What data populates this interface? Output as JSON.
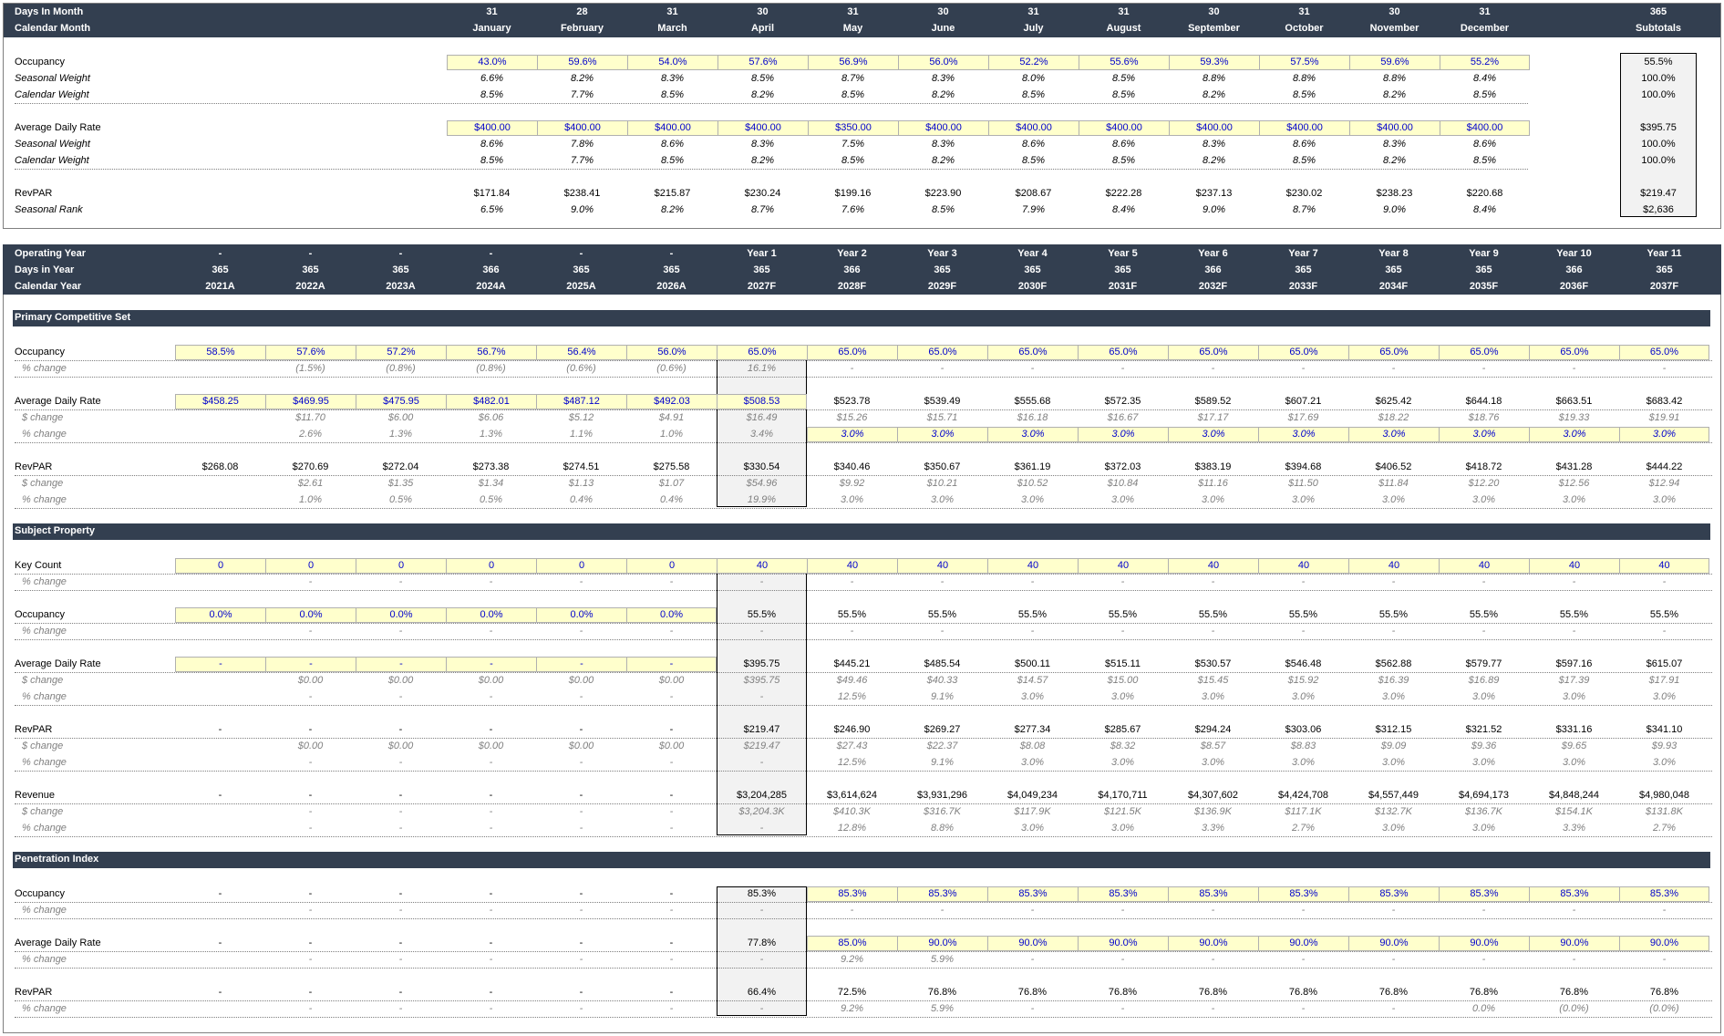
{
  "monthly": {
    "header_rows": [
      {
        "label": "Days In Month",
        "values": [
          "31",
          "28",
          "31",
          "30",
          "31",
          "30",
          "31",
          "31",
          "30",
          "31",
          "30",
          "31"
        ],
        "total": "365"
      },
      {
        "label": "Calendar Month",
        "values": [
          "January",
          "February",
          "March",
          "April",
          "May",
          "June",
          "July",
          "August",
          "September",
          "October",
          "November",
          "December"
        ],
        "total": "Subtotals"
      }
    ],
    "rows": [
      {
        "label": "Occupancy",
        "style": "input",
        "values": [
          "43.0%",
          "59.6%",
          "54.0%",
          "57.6%",
          "56.9%",
          "56.0%",
          "52.2%",
          "55.6%",
          "59.3%",
          "57.5%",
          "59.6%",
          "55.2%"
        ],
        "total": "55.5%"
      },
      {
        "label": "Seasonal Weight",
        "style": "italic",
        "values": [
          "6.6%",
          "8.2%",
          "8.3%",
          "8.5%",
          "8.7%",
          "8.3%",
          "8.0%",
          "8.5%",
          "8.8%",
          "8.8%",
          "8.8%",
          "8.4%"
        ],
        "total": "100.0%"
      },
      {
        "label": "Calendar Weight",
        "style": "italic-dotted",
        "values": [
          "8.5%",
          "7.7%",
          "8.5%",
          "8.2%",
          "8.5%",
          "8.2%",
          "8.5%",
          "8.5%",
          "8.2%",
          "8.5%",
          "8.2%",
          "8.5%"
        ],
        "total": "100.0%"
      },
      {
        "label": "Average Daily Rate",
        "style": "input",
        "values": [
          "$400.00",
          "$400.00",
          "$400.00",
          "$400.00",
          "$350.00",
          "$400.00",
          "$400.00",
          "$400.00",
          "$400.00",
          "$400.00",
          "$400.00",
          "$400.00"
        ],
        "total": "$395.75"
      },
      {
        "label": "Seasonal Weight",
        "style": "italic",
        "values": [
          "8.6%",
          "7.8%",
          "8.6%",
          "8.3%",
          "7.5%",
          "8.3%",
          "8.6%",
          "8.6%",
          "8.3%",
          "8.6%",
          "8.3%",
          "8.6%"
        ],
        "total": "100.0%"
      },
      {
        "label": "Calendar Weight",
        "style": "italic-dotted",
        "values": [
          "8.5%",
          "7.7%",
          "8.5%",
          "8.2%",
          "8.5%",
          "8.2%",
          "8.5%",
          "8.5%",
          "8.2%",
          "8.5%",
          "8.2%",
          "8.5%"
        ],
        "total": "100.0%"
      },
      {
        "label": "RevPAR",
        "style": "normal",
        "values": [
          "$171.84",
          "$238.41",
          "$215.87",
          "$230.24",
          "$199.16",
          "$223.90",
          "$208.67",
          "$222.28",
          "$237.13",
          "$230.02",
          "$238.23",
          "$220.68"
        ],
        "total": "$219.47"
      },
      {
        "label": "Seasonal Rank",
        "style": "italic",
        "values": [
          "6.5%",
          "9.0%",
          "8.2%",
          "8.7%",
          "7.6%",
          "8.5%",
          "7.9%",
          "8.4%",
          "9.0%",
          "8.7%",
          "9.0%",
          "8.4%"
        ],
        "total": "$2,636"
      }
    ]
  },
  "annual": {
    "header_rows": [
      {
        "label": "Operating Year",
        "values": [
          "-",
          "-",
          "-",
          "-",
          "-",
          "-",
          "Year 1",
          "Year 2",
          "Year 3",
          "Year 4",
          "Year 5",
          "Year 6",
          "Year 7",
          "Year 8",
          "Year 9",
          "Year 10",
          "Year 11"
        ]
      },
      {
        "label": "Days in Year",
        "values": [
          "365",
          "365",
          "365",
          "366",
          "365",
          "365",
          "365",
          "366",
          "365",
          "365",
          "365",
          "366",
          "365",
          "365",
          "365",
          "366",
          "365"
        ]
      },
      {
        "label": "Calendar Year",
        "values": [
          "2021A",
          "2022A",
          "2023A",
          "2024A",
          "2025A",
          "2026A",
          "2027F",
          "2028F",
          "2029F",
          "2030F",
          "2031F",
          "2032F",
          "2033F",
          "2034F",
          "2035F",
          "2036F",
          "2037F"
        ]
      }
    ],
    "sections": [
      {
        "title": "Primary Competitive Set",
        "rows": [
          {
            "label": "Occupancy",
            "style": "normal",
            "values": [
              "58.5%",
              "57.6%",
              "57.2%",
              "56.7%",
              "56.4%",
              "56.0%",
              "65.0%",
              "65.0%",
              "65.0%",
              "65.0%",
              "65.0%",
              "65.0%",
              "65.0%",
              "65.0%",
              "65.0%",
              "65.0%",
              "65.0%"
            ]
          },
          {
            "label": "% change",
            "style": "sub",
            "values": [
              "",
              "(1.5%)",
              "(0.8%)",
              "(0.8%)",
              "(0.6%)",
              "(0.6%)",
              "16.1%",
              "-",
              "-",
              "-",
              "-",
              "-",
              "-",
              "-",
              "-",
              "-",
              "-"
            ]
          },
          {
            "label": "Average Daily Rate",
            "style": "normal",
            "values": [
              "$458.25",
              "$469.95",
              "$475.95",
              "$482.01",
              "$487.12",
              "$492.03",
              "$508.53",
              "$523.78",
              "$539.49",
              "$555.68",
              "$572.35",
              "$589.52",
              "$607.21",
              "$625.42",
              "$644.18",
              "$663.51",
              "$683.42"
            ]
          },
          {
            "label": "$ change",
            "style": "sub",
            "values": [
              "",
              "$11.70",
              "$6.00",
              "$6.06",
              "$5.12",
              "$4.91",
              "$16.49",
              "$15.26",
              "$15.71",
              "$16.18",
              "$16.67",
              "$17.17",
              "$17.69",
              "$18.22",
              "$18.76",
              "$19.33",
              "$19.91"
            ]
          },
          {
            "label": "% change",
            "style": "sub",
            "values": [
              "",
              "2.6%",
              "1.3%",
              "1.3%",
              "1.1%",
              "1.0%",
              "3.4%",
              "3.0%",
              "3.0%",
              "3.0%",
              "3.0%",
              "3.0%",
              "3.0%",
              "3.0%",
              "3.0%",
              "3.0%",
              "3.0%"
            ]
          },
          {
            "label": "RevPAR",
            "style": "normal",
            "values": [
              "$268.08",
              "$270.69",
              "$272.04",
              "$273.38",
              "$274.51",
              "$275.58",
              "$330.54",
              "$340.46",
              "$350.67",
              "$361.19",
              "$372.03",
              "$383.19",
              "$394.68",
              "$406.52",
              "$418.72",
              "$431.28",
              "$444.22"
            ]
          },
          {
            "label": "$ change",
            "style": "sub",
            "values": [
              "",
              "$2.61",
              "$1.35",
              "$1.34",
              "$1.13",
              "$1.07",
              "$54.96",
              "$9.92",
              "$10.21",
              "$10.52",
              "$10.84",
              "$11.16",
              "$11.50",
              "$11.84",
              "$12.20",
              "$12.56",
              "$12.94"
            ]
          },
          {
            "label": "% change",
            "style": "sub",
            "values": [
              "",
              "1.0%",
              "0.5%",
              "0.5%",
              "0.4%",
              "0.4%",
              "19.9%",
              "3.0%",
              "3.0%",
              "3.0%",
              "3.0%",
              "3.0%",
              "3.0%",
              "3.0%",
              "3.0%",
              "3.0%",
              "3.0%"
            ]
          }
        ]
      },
      {
        "title": "Subject Property",
        "rows": [
          {
            "label": "Key Count",
            "style": "normal",
            "values": [
              "0",
              "0",
              "0",
              "0",
              "0",
              "0",
              "40",
              "40",
              "40",
              "40",
              "40",
              "40",
              "40",
              "40",
              "40",
              "40",
              "40"
            ]
          },
          {
            "label": "% change",
            "style": "sub",
            "values": [
              "",
              "-",
              "-",
              "-",
              "-",
              "-",
              "-",
              "-",
              "-",
              "-",
              "-",
              "-",
              "-",
              "-",
              "-",
              "-",
              "-"
            ]
          },
          {
            "label": "Occupancy",
            "style": "normal",
            "values": [
              "0.0%",
              "0.0%",
              "0.0%",
              "0.0%",
              "0.0%",
              "0.0%",
              "55.5%",
              "55.5%",
              "55.5%",
              "55.5%",
              "55.5%",
              "55.5%",
              "55.5%",
              "55.5%",
              "55.5%",
              "55.5%",
              "55.5%"
            ]
          },
          {
            "label": "% change",
            "style": "sub",
            "values": [
              "",
              "-",
              "-",
              "-",
              "-",
              "-",
              "-",
              "-",
              "-",
              "-",
              "-",
              "-",
              "-",
              "-",
              "-",
              "-",
              "-"
            ]
          },
          {
            "label": "Average Daily Rate",
            "style": "normal",
            "values": [
              "-",
              "-",
              "-",
              "-",
              "-",
              "-",
              "$395.75",
              "$445.21",
              "$485.54",
              "$500.11",
              "$515.11",
              "$530.57",
              "$546.48",
              "$562.88",
              "$579.77",
              "$597.16",
              "$615.07"
            ]
          },
          {
            "label": "$ change",
            "style": "sub",
            "values": [
              "",
              "$0.00",
              "$0.00",
              "$0.00",
              "$0.00",
              "$0.00",
              "$395.75",
              "$49.46",
              "$40.33",
              "$14.57",
              "$15.00",
              "$15.45",
              "$15.92",
              "$16.39",
              "$16.89",
              "$17.39",
              "$17.91"
            ]
          },
          {
            "label": "% change",
            "style": "sub",
            "values": [
              "",
              "-",
              "-",
              "-",
              "-",
              "-",
              "-",
              "12.5%",
              "9.1%",
              "3.0%",
              "3.0%",
              "3.0%",
              "3.0%",
              "3.0%",
              "3.0%",
              "3.0%",
              "3.0%"
            ]
          },
          {
            "label": "RevPAR",
            "style": "normal",
            "values": [
              "-",
              "-",
              "-",
              "-",
              "-",
              "-",
              "$219.47",
              "$246.90",
              "$269.27",
              "$277.34",
              "$285.67",
              "$294.24",
              "$303.06",
              "$312.15",
              "$321.52",
              "$331.16",
              "$341.10"
            ]
          },
          {
            "label": "$ change",
            "style": "sub",
            "values": [
              "",
              "$0.00",
              "$0.00",
              "$0.00",
              "$0.00",
              "$0.00",
              "$219.47",
              "$27.43",
              "$22.37",
              "$8.08",
              "$8.32",
              "$8.57",
              "$8.83",
              "$9.09",
              "$9.36",
              "$9.65",
              "$9.93"
            ]
          },
          {
            "label": "% change",
            "style": "sub",
            "values": [
              "",
              "-",
              "-",
              "-",
              "-",
              "-",
              "-",
              "12.5%",
              "9.1%",
              "3.0%",
              "3.0%",
              "3.0%",
              "3.0%",
              "3.0%",
              "3.0%",
              "3.0%",
              "3.0%"
            ]
          },
          {
            "label": "Revenue",
            "style": "normal",
            "values": [
              "-",
              "-",
              "-",
              "-",
              "-",
              "-",
              "$3,204,285",
              "$3,614,624",
              "$3,931,296",
              "$4,049,234",
              "$4,170,711",
              "$4,307,602",
              "$4,424,708",
              "$4,557,449",
              "$4,694,173",
              "$4,848,244",
              "$4,980,048"
            ]
          },
          {
            "label": "$ change",
            "style": "sub",
            "values": [
              "",
              "-",
              "-",
              "-",
              "-",
              "-",
              "$3,204.3K",
              "$410.3K",
              "$316.7K",
              "$117.9K",
              "$121.5K",
              "$136.9K",
              "$117.1K",
              "$132.7K",
              "$136.7K",
              "$154.1K",
              "$131.8K"
            ]
          },
          {
            "label": "% change",
            "style": "sub",
            "values": [
              "",
              "-",
              "-",
              "-",
              "-",
              "-",
              "-",
              "12.8%",
              "8.8%",
              "3.0%",
              "3.0%",
              "3.3%",
              "2.7%",
              "3.0%",
              "3.0%",
              "3.3%",
              "2.7%"
            ]
          }
        ]
      },
      {
        "title": "Penetration Index",
        "rows": [
          {
            "label": "Occupancy",
            "style": "normal",
            "values": [
              "-",
              "-",
              "-",
              "-",
              "-",
              "-",
              "85.3%",
              "85.3%",
              "85.3%",
              "85.3%",
              "85.3%",
              "85.3%",
              "85.3%",
              "85.3%",
              "85.3%",
              "85.3%",
              "85.3%"
            ]
          },
          {
            "label": "% change",
            "style": "sub",
            "values": [
              "",
              "-",
              "-",
              "-",
              "-",
              "-",
              "-",
              "-",
              "-",
              "-",
              "-",
              "-",
              "-",
              "-",
              "-",
              "-",
              "-"
            ]
          },
          {
            "label": "Average Daily Rate",
            "style": "normal",
            "values": [
              "-",
              "-",
              "-",
              "-",
              "-",
              "-",
              "77.8%",
              "85.0%",
              "90.0%",
              "90.0%",
              "90.0%",
              "90.0%",
              "90.0%",
              "90.0%",
              "90.0%",
              "90.0%",
              "90.0%"
            ]
          },
          {
            "label": "% change",
            "style": "sub",
            "values": [
              "",
              "-",
              "-",
              "-",
              "-",
              "-",
              "-",
              "9.2%",
              "5.9%",
              "-",
              "-",
              "-",
              "-",
              "-",
              "-",
              "-",
              "-"
            ]
          },
          {
            "label": "RevPAR",
            "style": "normal",
            "values": [
              "-",
              "-",
              "-",
              "-",
              "-",
              "-",
              "66.4%",
              "72.5%",
              "76.8%",
              "76.8%",
              "76.8%",
              "76.8%",
              "76.8%",
              "76.8%",
              "76.8%",
              "76.8%",
              "76.8%"
            ]
          },
          {
            "label": "% change",
            "style": "sub",
            "values": [
              "",
              "-",
              "-",
              "-",
              "-",
              "-",
              "-",
              "9.2%",
              "5.9%",
              "-",
              "-",
              "-",
              "-",
              "-",
              "0.0%",
              "(0.0%)",
              "(0.0%)",
              "0.0%"
            ]
          }
        ]
      }
    ]
  },
  "colors": {
    "header_bg": "#333f50",
    "header_text": "#ffffff",
    "input_fill": "#ffffcc",
    "input_text": "#0000cc",
    "sub_text": "#808080",
    "total_box_fill": "#f2f2f2"
  }
}
